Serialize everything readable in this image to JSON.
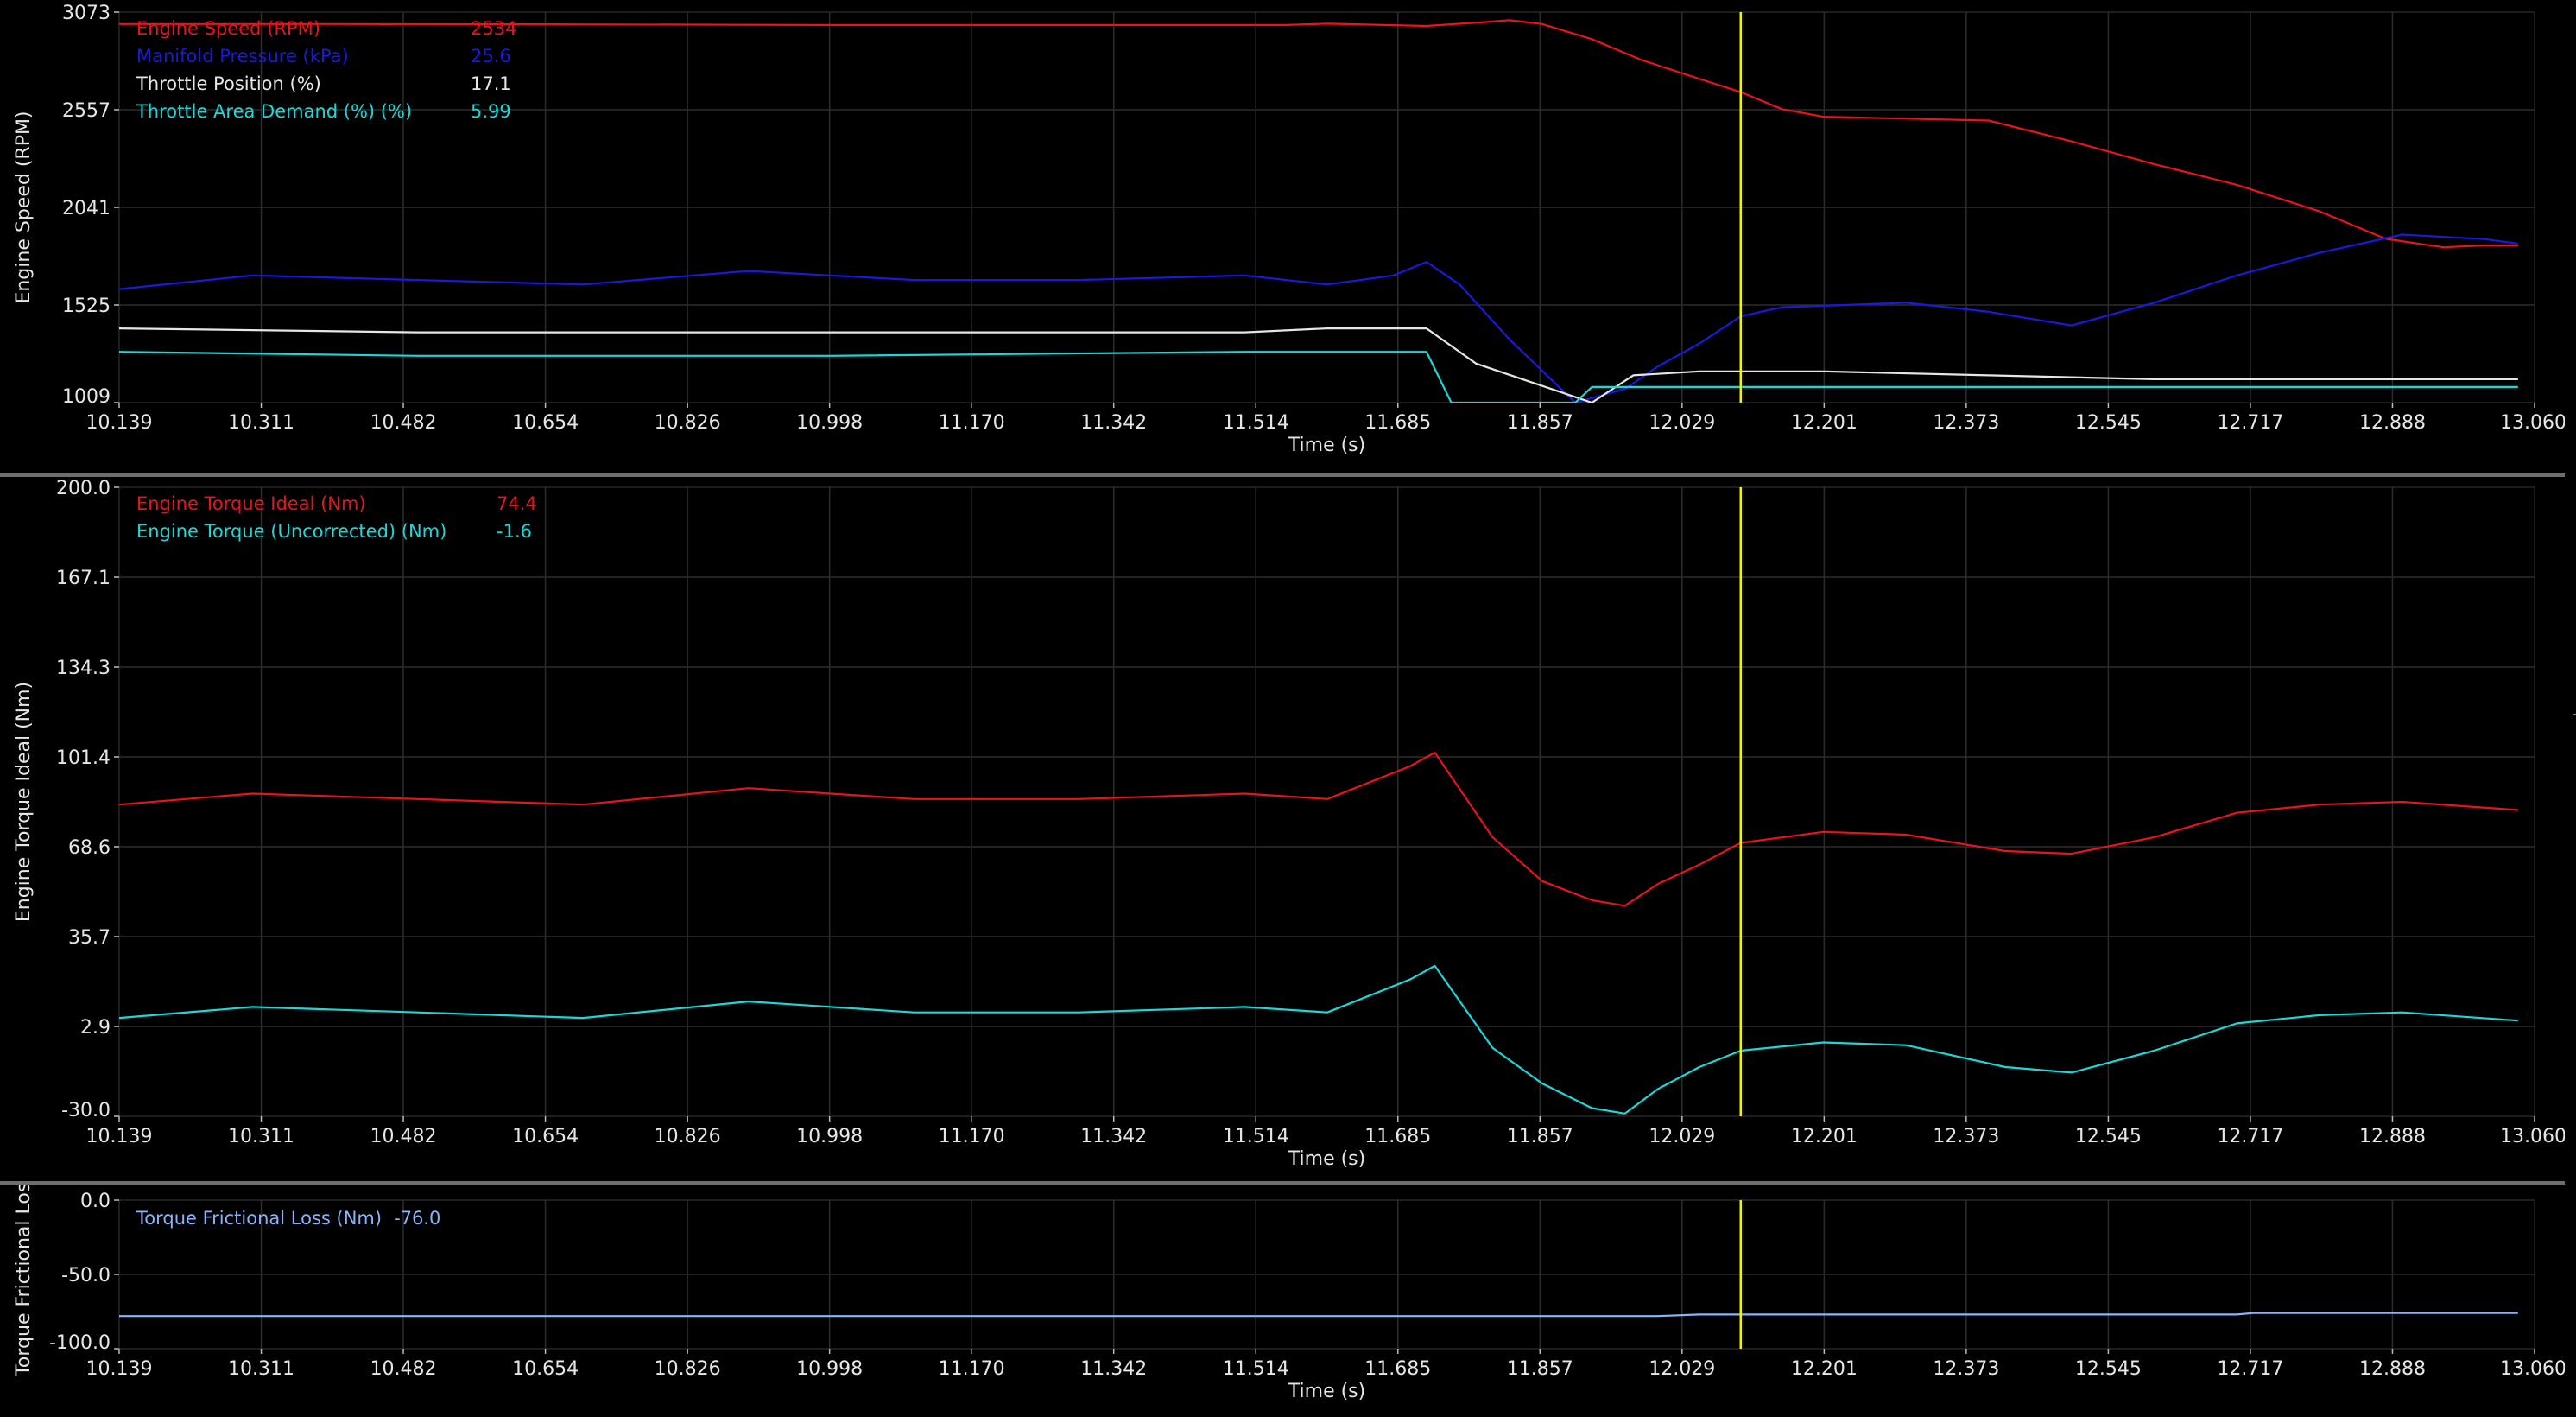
{
  "cursor_time": 12.1,
  "chart_data": [
    {
      "type": "line",
      "ylabel": "Engine Speed (RPM)",
      "xlabel": "Time (s)",
      "xlim": [
        10.139,
        13.06
      ],
      "ylim": [
        1009,
        3073
      ],
      "x_ticks": [
        "10.139",
        "10.311",
        "10.482",
        "10.654",
        "10.826",
        "10.998",
        "11.170",
        "11.342",
        "11.514",
        "11.685",
        "11.857",
        "12.029",
        "12.201",
        "12.373",
        "12.545",
        "12.717",
        "12.888",
        "13.060"
      ],
      "y_ticks": [
        "3073",
        "2557",
        "2041",
        "1525",
        "1009"
      ],
      "series": [
        {
          "name": "Engine Speed (RPM)",
          "value": "2534",
          "color": "#e8141c",
          "axis_min": 1009,
          "axis_max": 3073,
          "x": [
            10.139,
            10.4,
            10.7,
            11.0,
            11.3,
            11.55,
            11.6,
            11.72,
            11.79,
            11.82,
            11.86,
            11.92,
            11.98,
            12.05,
            12.1,
            12.15,
            12.2,
            12.3,
            12.4,
            12.5,
            12.6,
            12.7,
            12.8,
            12.88,
            12.95,
            13.0,
            13.04
          ],
          "y": [
            3010,
            3010,
            3008,
            3005,
            3005,
            3005,
            3012,
            3000,
            3020,
            3030,
            3010,
            2930,
            2820,
            2720,
            2650,
            2560,
            2520,
            2510,
            2500,
            2390,
            2270,
            2160,
            2020,
            1875,
            1830,
            1840,
            1840
          ]
        },
        {
          "name": "Manifold Pressure (kPa)",
          "value": "25.6",
          "color": "#1a1adc",
          "axis_min": 14,
          "axis_max": 100,
          "x": [
            10.139,
            10.3,
            10.5,
            10.7,
            10.9,
            11.1,
            11.3,
            11.5,
            11.6,
            11.68,
            11.72,
            11.76,
            11.82,
            11.9,
            11.96,
            12.0,
            12.05,
            12.1,
            12.15,
            12.3,
            12.4,
            12.5,
            12.6,
            12.7,
            12.8,
            12.9,
            13.0,
            13.04
          ],
          "y": [
            39,
            42,
            41,
            40,
            43,
            41,
            41,
            42,
            40,
            42,
            45,
            40,
            28,
            14,
            17,
            22,
            27,
            33,
            35,
            36,
            34,
            31,
            36,
            42,
            47,
            51,
            50,
            49
          ]
        },
        {
          "name": "Throttle Position (%)",
          "value": "17.1",
          "color": "#e6e6e6",
          "axis_min": 0,
          "axis_max": 100,
          "x": [
            10.139,
            10.5,
            11.0,
            11.5,
            11.6,
            11.72,
            11.78,
            11.85,
            11.92,
            11.97,
            12.05,
            12.2,
            12.4,
            12.6,
            12.8,
            13.04
          ],
          "y": [
            19,
            18,
            18,
            18,
            19,
            19,
            10,
            5,
            0,
            7,
            8,
            8,
            7,
            6,
            6,
            6
          ]
        },
        {
          "name": "Throttle Area Demand  (%) (%)",
          "value": "5.99",
          "color": "#1ad8d8",
          "axis_min": 0,
          "axis_max": 100,
          "x": [
            10.139,
            10.5,
            11.0,
            11.5,
            11.6,
            11.72,
            11.75,
            11.9,
            11.92,
            11.95,
            12.2,
            12.5,
            12.8,
            13.04
          ],
          "y": [
            13,
            12,
            12,
            13,
            13,
            13,
            0,
            0,
            4,
            4,
            4,
            4,
            4,
            4
          ]
        }
      ]
    },
    {
      "type": "line",
      "ylabel": "Engine Torque Ideal (Nm)",
      "xlabel": "Time (s)",
      "xlim": [
        10.139,
        13.06
      ],
      "ylim": [
        -30.0,
        200.0
      ],
      "x_ticks": [
        "10.139",
        "10.311",
        "10.482",
        "10.654",
        "10.826",
        "10.998",
        "11.170",
        "11.342",
        "11.514",
        "11.685",
        "11.857",
        "12.029",
        "12.201",
        "12.373",
        "12.545",
        "12.717",
        "12.888",
        "13.060"
      ],
      "y_ticks": [
        "200.0",
        "167.1",
        "134.3",
        "101.4",
        "68.6",
        "35.7",
        "2.9",
        "-30.0"
      ],
      "series": [
        {
          "name": "Engine Torque Ideal (Nm)",
          "value": "74.4",
          "color": "#e8141c",
          "x": [
            10.139,
            10.3,
            10.5,
            10.7,
            10.9,
            11.1,
            11.3,
            11.5,
            11.6,
            11.7,
            11.73,
            11.8,
            11.86,
            11.92,
            11.96,
            12.0,
            12.05,
            12.1,
            12.2,
            12.3,
            12.42,
            12.5,
            12.6,
            12.7,
            12.8,
            12.9,
            13.04
          ],
          "y": [
            84,
            88,
            86,
            84,
            90,
            86,
            86,
            88,
            86,
            98,
            103,
            72,
            56,
            49,
            47,
            55,
            62,
            70,
            74,
            73,
            67,
            66,
            72,
            81,
            84,
            85,
            82
          ]
        },
        {
          "name": "Engine Torque (Uncorrected) (Nm)",
          "value": "-1.6",
          "color": "#1ad8d8",
          "x": [
            10.139,
            10.3,
            10.5,
            10.7,
            10.9,
            11.1,
            11.3,
            11.5,
            11.6,
            11.7,
            11.73,
            11.8,
            11.86,
            11.92,
            11.96,
            12.0,
            12.05,
            12.1,
            12.2,
            12.3,
            12.42,
            12.5,
            12.6,
            12.7,
            12.8,
            12.9,
            13.04
          ],
          "y": [
            6,
            10,
            8,
            6,
            12,
            8,
            8,
            10,
            8,
            20,
            25,
            -5,
            -18,
            -27,
            -29,
            -20,
            -12,
            -6,
            -3,
            -4,
            -12,
            -14,
            -6,
            4,
            7,
            8,
            5
          ]
        }
      ]
    },
    {
      "type": "line",
      "ylabel": "Torque Frictional Loss",
      "xlabel": "Time (s)",
      "xlim": [
        10.139,
        13.06
      ],
      "ylim": [
        -100.0,
        0.0
      ],
      "x_ticks": [
        "10.139",
        "10.311",
        "10.482",
        "10.654",
        "10.826",
        "10.998",
        "11.170",
        "11.342",
        "11.514",
        "11.685",
        "11.857",
        "12.029",
        "12.201",
        "12.373",
        "12.545",
        "12.717",
        "12.888",
        "13.060"
      ],
      "y_ticks": [
        "0.0",
        "-50.0",
        "-100.0"
      ],
      "series": [
        {
          "name": "Torque Frictional Loss (Nm)",
          "value": "-76.0",
          "color": "#8ab4f8",
          "x": [
            10.139,
            11.0,
            12.0,
            12.05,
            12.5,
            12.7,
            12.72,
            13.04
          ],
          "y": [
            -78,
            -78,
            -78,
            -77,
            -77,
            -77,
            -76,
            -76
          ]
        }
      ]
    }
  ]
}
